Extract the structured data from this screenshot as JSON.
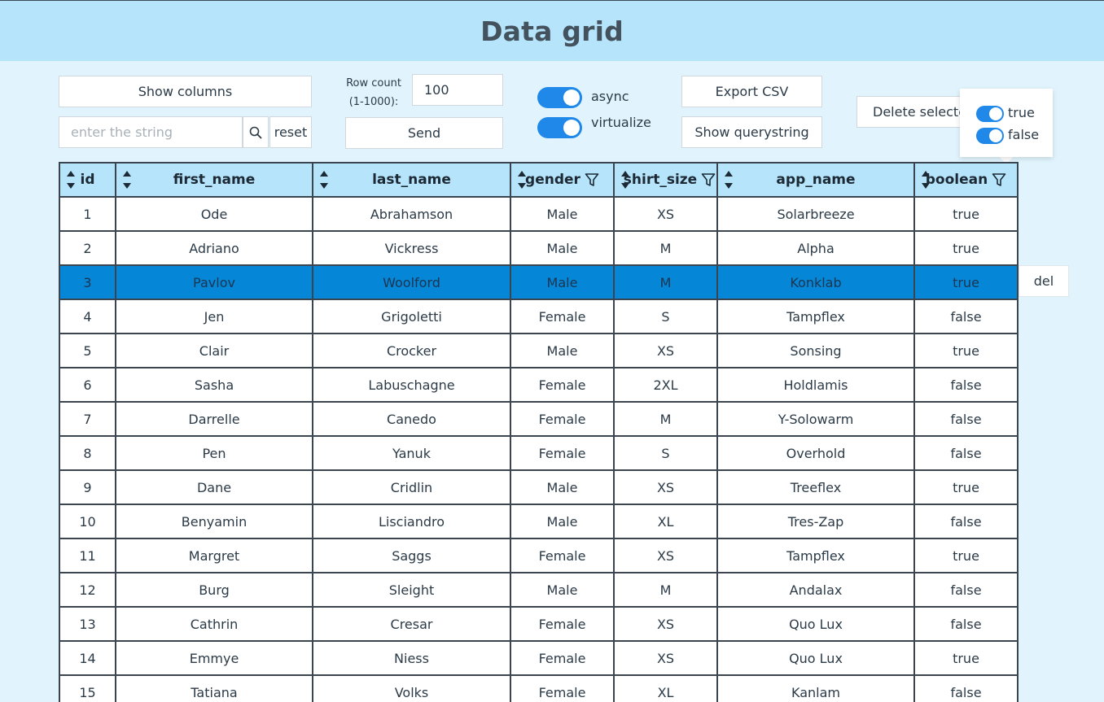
{
  "header": {
    "title": "Data grid"
  },
  "controls": {
    "show_columns_label": "Show columns",
    "search_placeholder": "enter the string",
    "reset_label": "reset",
    "row_count_label_line1": "Row count",
    "row_count_label_line2": "(1-1000):",
    "row_count_value": "100",
    "send_label": "Send",
    "async_label": "async",
    "async_on": true,
    "virtualize_label": "virtualize",
    "virtualize_on": true,
    "export_csv_label": "Export CSV",
    "show_querystring_label": "Show querystring",
    "delete_selected_label": "Delete selected"
  },
  "filter_popup": {
    "options": [
      {
        "label": "true",
        "checked": true
      },
      {
        "label": "false",
        "checked": true
      }
    ]
  },
  "grid": {
    "columns": [
      "id",
      "first_name",
      "last_name",
      "gender",
      "shirt_size",
      "app_name",
      "boolean"
    ],
    "filterable_columns": [
      "gender",
      "shirt_size",
      "boolean"
    ],
    "selected_row_id": "3",
    "rows": [
      [
        "1",
        "Ode",
        "Abrahamson",
        "Male",
        "XS",
        "Solarbreeze",
        "true"
      ],
      [
        "2",
        "Adriano",
        "Vickress",
        "Male",
        "M",
        "Alpha",
        "true"
      ],
      [
        "3",
        "Pavlov",
        "Woolford",
        "Male",
        "M",
        "Konklab",
        "true"
      ],
      [
        "4",
        "Jen",
        "Grigoletti",
        "Female",
        "S",
        "Tampflex",
        "false"
      ],
      [
        "5",
        "Clair",
        "Crocker",
        "Male",
        "XS",
        "Sonsing",
        "true"
      ],
      [
        "6",
        "Sasha",
        "Labuschagne",
        "Female",
        "2XL",
        "Holdlamis",
        "false"
      ],
      [
        "7",
        "Darrelle",
        "Canedo",
        "Female",
        "M",
        "Y-Solowarm",
        "false"
      ],
      [
        "8",
        "Pen",
        "Yanuk",
        "Female",
        "S",
        "Overhold",
        "false"
      ],
      [
        "9",
        "Dane",
        "Cridlin",
        "Male",
        "XS",
        "Treeflex",
        "true"
      ],
      [
        "10",
        "Benyamin",
        "Lisciandro",
        "Male",
        "XL",
        "Tres-Zap",
        "false"
      ],
      [
        "11",
        "Margret",
        "Saggs",
        "Female",
        "XS",
        "Tampflex",
        "true"
      ],
      [
        "12",
        "Burg",
        "Sleight",
        "Male",
        "M",
        "Andalax",
        "false"
      ],
      [
        "13",
        "Cathrin",
        "Cresar",
        "Female",
        "XS",
        "Quo Lux",
        "false"
      ],
      [
        "14",
        "Emmye",
        "Niess",
        "Female",
        "XS",
        "Quo Lux",
        "true"
      ],
      [
        "15",
        "Tatiana",
        "Volks",
        "Female",
        "XL",
        "Kanlam",
        "false"
      ]
    ],
    "row_action_label": "del"
  },
  "colors": {
    "header_bg": "#b5e4fb",
    "page_bg": "#e1f4fd",
    "selected_row": "#0586d6",
    "toggle_on": "#1f88e8"
  }
}
